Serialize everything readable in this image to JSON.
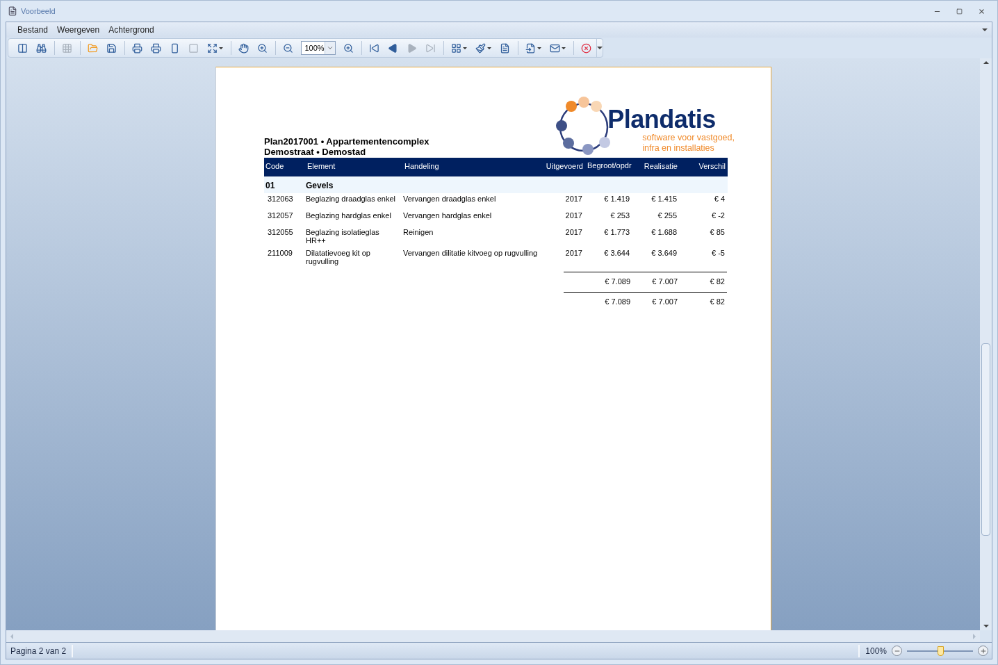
{
  "window": {
    "title": "Voorbeeld"
  },
  "menu": [
    {
      "label": "Bestand"
    },
    {
      "label": "Weergeven"
    },
    {
      "label": "Achtergrond"
    }
  ],
  "toolbar": {
    "zoom": "100%",
    "buttons": [
      {
        "disabled": false
      },
      {
        "disabled": false
      },
      {
        "disabled": true
      },
      {
        "disabled": false
      },
      {
        "disabled": false
      },
      {
        "disabled": false
      },
      {
        "disabled": false
      },
      {
        "disabled": false
      },
      {
        "disabled": true
      },
      {
        "disabled": false
      },
      {
        "disabled": false
      },
      {
        "disabled": false
      },
      {
        "disabled": false
      },
      {
        "disabled": false
      },
      {
        "disabled": false
      },
      {
        "disabled": false
      },
      {
        "disabled": true
      },
      {
        "disabled": true
      },
      {
        "disabled": false
      },
      {
        "disabled": false
      },
      {
        "disabled": false
      },
      {
        "disabled": false
      },
      {
        "disabled": false
      },
      {
        "disabled": false
      }
    ]
  },
  "report": {
    "title": "Plan2017001 • Appartementencomplex",
    "subtitle": "Demostraat • Demostad",
    "logo": {
      "name": "Plandatis",
      "tagline_1": "software voor vastgoed,",
      "tagline_2": "infra en installaties"
    },
    "columns": [
      "Code",
      "Element",
      "Handeling",
      "Uitgevoerd",
      "Begroot/opdr",
      "Realisatie",
      "Verschil"
    ],
    "group": {
      "code": "01",
      "name": "Gevels"
    },
    "rows": [
      {
        "code": "312063",
        "element": "Beglazing draadglas enkel",
        "handeling": "Vervangen draadglas enkel",
        "uitgevoerd": "2017",
        "begroot": "€ 1.419",
        "realisatie": "€ 1.415",
        "verschil": "€ 4"
      },
      {
        "code": "312057",
        "element": "Beglazing hardglas enkel",
        "handeling": "Vervangen hardglas enkel",
        "uitgevoerd": "2017",
        "begroot": "€ 253",
        "realisatie": "€ 255",
        "verschil": "€ -2"
      },
      {
        "code": "312055",
        "element": "Beglazing isolatieglas HR++",
        "handeling": "Reinigen",
        "uitgevoerd": "2017",
        "begroot": "€ 1.773",
        "realisatie": "€ 1.688",
        "verschil": "€ 85"
      },
      {
        "code": "211009",
        "element": "Dilatatievoeg kit op rugvulling",
        "handeling": "Vervangen dilitatie kitvoeg op rugvulling",
        "uitgevoerd": "2017",
        "begroot": "€ 3.644",
        "realisatie": "€ 3.649",
        "verschil": "€ -5"
      }
    ],
    "totals": [
      {
        "begroot": "€ 7.089",
        "realisatie": "€ 7.007",
        "verschil": "€ 82"
      },
      {
        "begroot": "€ 7.089",
        "realisatie": "€ 7.007",
        "verschil": "€ 82"
      }
    ]
  },
  "status_bar": {
    "page": "Pagina 2 van 2",
    "zoom": "100%",
    "zoom_slider": {
      "level": 0.5
    }
  }
}
